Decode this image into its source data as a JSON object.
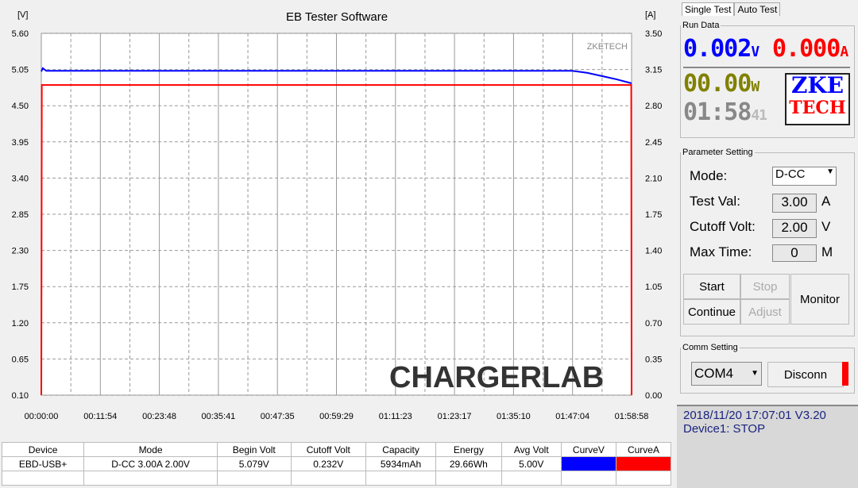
{
  "chart_data": {
    "type": "line",
    "title": "EB Tester Software",
    "ylabel_left": "[V]",
    "ylabel_right": "[A]",
    "watermark": "ZKETECH",
    "left_ticks": [
      "0.10",
      "0.65",
      "1.20",
      "1.75",
      "2.30",
      "2.85",
      "3.40",
      "3.95",
      "4.50",
      "5.05",
      "5.60"
    ],
    "right_ticks": [
      "0.00",
      "0.35",
      "0.70",
      "1.05",
      "1.40",
      "1.75",
      "2.10",
      "2.45",
      "2.80",
      "3.15",
      "3.50"
    ],
    "x_ticks": [
      "00:00:00",
      "00:11:54",
      "00:23:48",
      "00:35:41",
      "00:47:35",
      "00:59:29",
      "01:11:23",
      "01:23:17",
      "01:35:10",
      "01:47:04",
      "01:58:58"
    ],
    "ylim_left": [
      0.1,
      5.6
    ],
    "ylim_right": [
      0.0,
      3.5
    ],
    "grid": true,
    "series": [
      {
        "name": "CurveV",
        "axis": "left",
        "color": "#0000ff",
        "x_min": [
          0,
          0.3,
          1,
          10,
          107,
          110,
          113,
          116,
          118.97
        ],
        "values": [
          5.02,
          5.07,
          5.03,
          5.03,
          5.03,
          5.0,
          4.95,
          4.9,
          4.84
        ]
      },
      {
        "name": "CurveA",
        "axis": "right",
        "color": "#ff0000",
        "x_min": [
          0,
          0.1,
          118.9,
          118.97
        ],
        "values": [
          0,
          3.0,
          3.0,
          0
        ]
      }
    ]
  },
  "overlay_logo": "CHARGERLAB",
  "tabs": [
    "Single Test",
    "Auto Test"
  ],
  "run_data": {
    "legend": "Run Data",
    "voltage": "0.002",
    "v_unit": "V",
    "current": "0.000",
    "a_unit": "A",
    "power": "00.00",
    "w_unit": "W",
    "time": "01:58",
    "time_sec": "41",
    "logo_top": "ZKE",
    "logo_bottom": "TECH"
  },
  "params": {
    "legend": "Parameter Setting",
    "mode_label": "Mode:",
    "mode_value": "D-CC",
    "test_label": "Test Val:",
    "test_value": "3.00",
    "test_unit": "A",
    "cutoff_label": "Cutoff Volt:",
    "cutoff_value": "2.00",
    "cutoff_unit": "V",
    "max_label": "Max Time:",
    "max_value": "0",
    "max_unit": "M"
  },
  "buttons": {
    "start": "Start",
    "stop": "Stop",
    "continue": "Continue",
    "adjust": "Adjust",
    "monitor": "Monitor"
  },
  "comm": {
    "legend": "Comm Setting",
    "port": "COM4",
    "disconn": "Disconn"
  },
  "status": {
    "line1": "2018/11/20 17:07:01  V3.20",
    "line2": "Device1: STOP"
  },
  "table": {
    "headers": [
      "Device",
      "Mode",
      "Begin Volt",
      "Cutoff Volt",
      "Capacity",
      "Energy",
      "Avg Volt",
      "CurveV",
      "CurveA"
    ],
    "row": [
      "EBD-USB+",
      "D-CC  3.00A  2.00V",
      "5.079V",
      "0.232V",
      "5934mAh",
      "29.66Wh",
      "5.00V"
    ],
    "curve_colors": [
      "#0000ff",
      "#ff0000"
    ]
  }
}
